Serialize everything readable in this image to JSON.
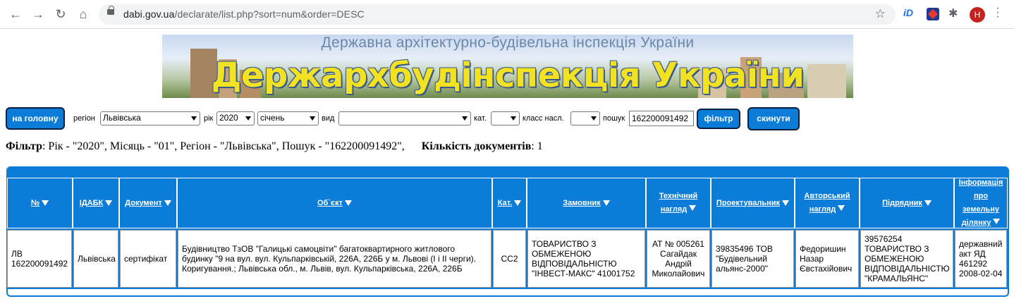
{
  "browser": {
    "url_domain": "dabi.gov.ua",
    "url_path": "/declarate/list.php?sort=num&order=DESC",
    "avatar_letter": "H"
  },
  "banner": {
    "subtitle": "Державна архітектурно-будівельна інспекція України",
    "title": "Держархбудінспекція України"
  },
  "filter_bar": {
    "home_button": "на головну",
    "region_label": "регіон",
    "region_value": "Львівська",
    "year_label": "рік",
    "year_value": "2020",
    "month_value": "січень",
    "type_label": "вид",
    "type_value": "",
    "category_label": "кат.",
    "category_value": "",
    "class_label": "класс насл.",
    "class_value": "",
    "search_label": "пошук",
    "search_value": "162200091492",
    "filter_button": "фільтр",
    "reset_button": "скинути"
  },
  "summary": {
    "filter_label": "Фільтр",
    "filter_text": ": Рік - \"2020\", Місяць - \"01\", Регіон - \"Львівська\", Пошук - \"162200091492\",",
    "count_label": "Кількість документів",
    "count_value": ": 1"
  },
  "table": {
    "headers": [
      {
        "l1": "№",
        "l2": ""
      },
      {
        "l1": "IДАБК",
        "l2": ""
      },
      {
        "l1": "Документ",
        "l2": ""
      },
      {
        "l1": "Об`єкт",
        "l2": ""
      },
      {
        "l1": "Кат.",
        "l2": ""
      },
      {
        "l1": "Замовник",
        "l2": ""
      },
      {
        "l1": "Технічний",
        "l2": "нагляд"
      },
      {
        "l1": "Проектувальник",
        "l2": ""
      },
      {
        "l1": "Авторський",
        "l2": "нагляд"
      },
      {
        "l1": "Підрядник",
        "l2": ""
      },
      {
        "l1": "Інформація",
        "l2": "про",
        "l3": "земельну",
        "l4": "ділянку"
      }
    ],
    "rows": [
      {
        "num": "ЛВ 162200091492",
        "idabk": "Львівська",
        "document": "сертифікат",
        "object": "Будівництво ТзОВ \"Галицькі самоцвіти\" багатоквартирного житлового будинку \"9 на вул. вул. Кульпарківській, 226А, 226Б у м. Львові (І і ІІ черги). Коригування.; Львівська обл., м. Львів, вул. Кульпарківська, 226А, 226Б",
        "category": "СС2",
        "customer": "ТОВАРИСТВО З ОБМЕЖЕНОЮ ВІДПОВІДАЛЬНІСТЮ \"ІНВЕСТ-МАКС\" 41001752",
        "tech_supervision": "АТ № 005261 Сагайдак Андрій Миколайович",
        "designer": "39835496 ТОВ \"Будівельний альянс-2000\"",
        "author_supervision": "Федоришин Назар Євстахійович",
        "contractor": "39576254 ТОВАРИСТВО З ОБМЕЖЕНОЮ ВІДПОВІДАЛЬНІСТЮ \"КРАМАЛЬЯНС\"",
        "land_info": "державний акт ЯД 461292 2008-02-04"
      }
    ]
  },
  "colors": {
    "header_blue": "#0b7dd8",
    "banner_yellow": "#f3e221"
  }
}
